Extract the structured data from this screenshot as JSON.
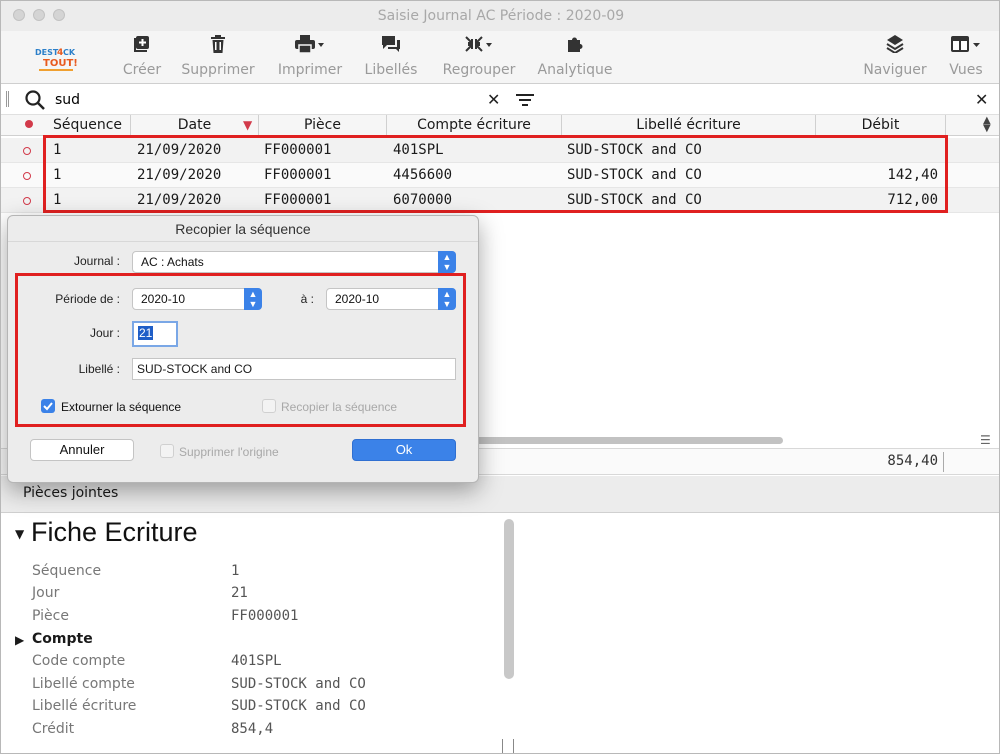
{
  "window": {
    "title": "Saisie Journal AC Période : 2020-09"
  },
  "toolbar": {
    "items": [
      {
        "label": "Créer",
        "icon": "plus-square-icon"
      },
      {
        "label": "Supprimer",
        "icon": "trash-icon"
      },
      {
        "label": "Imprimer",
        "icon": "printer-icon"
      },
      {
        "label": "Libellés",
        "icon": "speech-bubbles-icon"
      },
      {
        "label": "Regrouper",
        "icon": "collapse-arrows-icon"
      },
      {
        "label": "Analytique",
        "icon": "puzzle-icon"
      },
      {
        "label": "Naviguer",
        "icon": "layers-icon"
      },
      {
        "label": "Vues",
        "icon": "layout-icon"
      }
    ],
    "logo_text": "DEST4CK TOUT!"
  },
  "search": {
    "value": "sud"
  },
  "grid": {
    "columns": [
      "Séquence",
      "Date",
      "Pièce",
      "Compte écriture",
      "Libellé écriture",
      "Débit"
    ],
    "rows": [
      {
        "sequence": "1",
        "date": "21/09/2020",
        "piece": "FF000001",
        "compte": "401SPL",
        "libelle": "SUD-STOCK and CO",
        "debit": ""
      },
      {
        "sequence": "1",
        "date": "21/09/2020",
        "piece": "FF000001",
        "compte": "4456600",
        "libelle": "SUD-STOCK and CO",
        "debit": "142,40"
      },
      {
        "sequence": "1",
        "date": "21/09/2020",
        "piece": "FF000001",
        "compte": "6070000",
        "libelle": "SUD-STOCK and CO",
        "debit": "712,00"
      }
    ],
    "total_debit": "854,40"
  },
  "dialog": {
    "title": "Recopier la séquence",
    "journal_label": "Journal :",
    "journal_value": "AC : Achats",
    "periode_de_label": "Période de :",
    "periode_de_value": "2020-10",
    "periode_a_label": "à :",
    "periode_a_value": "2020-10",
    "jour_label": "Jour :",
    "jour_value": "21",
    "libelle_label": "Libellé :",
    "libelle_value": "SUD-STOCK and CO",
    "extourner_label": "Extourner la séquence",
    "extourner_checked": true,
    "recopier_label": "Recopier la séquence",
    "recopier_checked": false,
    "supprimer_label": "Supprimer l'origine",
    "supprimer_checked": false,
    "cancel_label": "Annuler",
    "ok_label": "Ok"
  },
  "attachments": {
    "label": "Pièces jointes"
  },
  "fiche": {
    "title": "Fiche Ecriture",
    "fields": [
      {
        "label": "Séquence",
        "value": "1"
      },
      {
        "label": "Jour",
        "value": "21"
      },
      {
        "label": "Pièce",
        "value": "FF000001"
      }
    ],
    "compte_section": "Compte",
    "compte_fields": [
      {
        "label": "Code compte",
        "value": "401SPL"
      },
      {
        "label": "Libellé compte",
        "value": "SUD-STOCK and CO"
      },
      {
        "label": "Libellé écriture",
        "value": "SUD-STOCK and CO"
      },
      {
        "label": "Crédit",
        "value": "854,4"
      }
    ]
  },
  "colors": {
    "accent": "#3b82e8",
    "highlight": "#e02020"
  }
}
